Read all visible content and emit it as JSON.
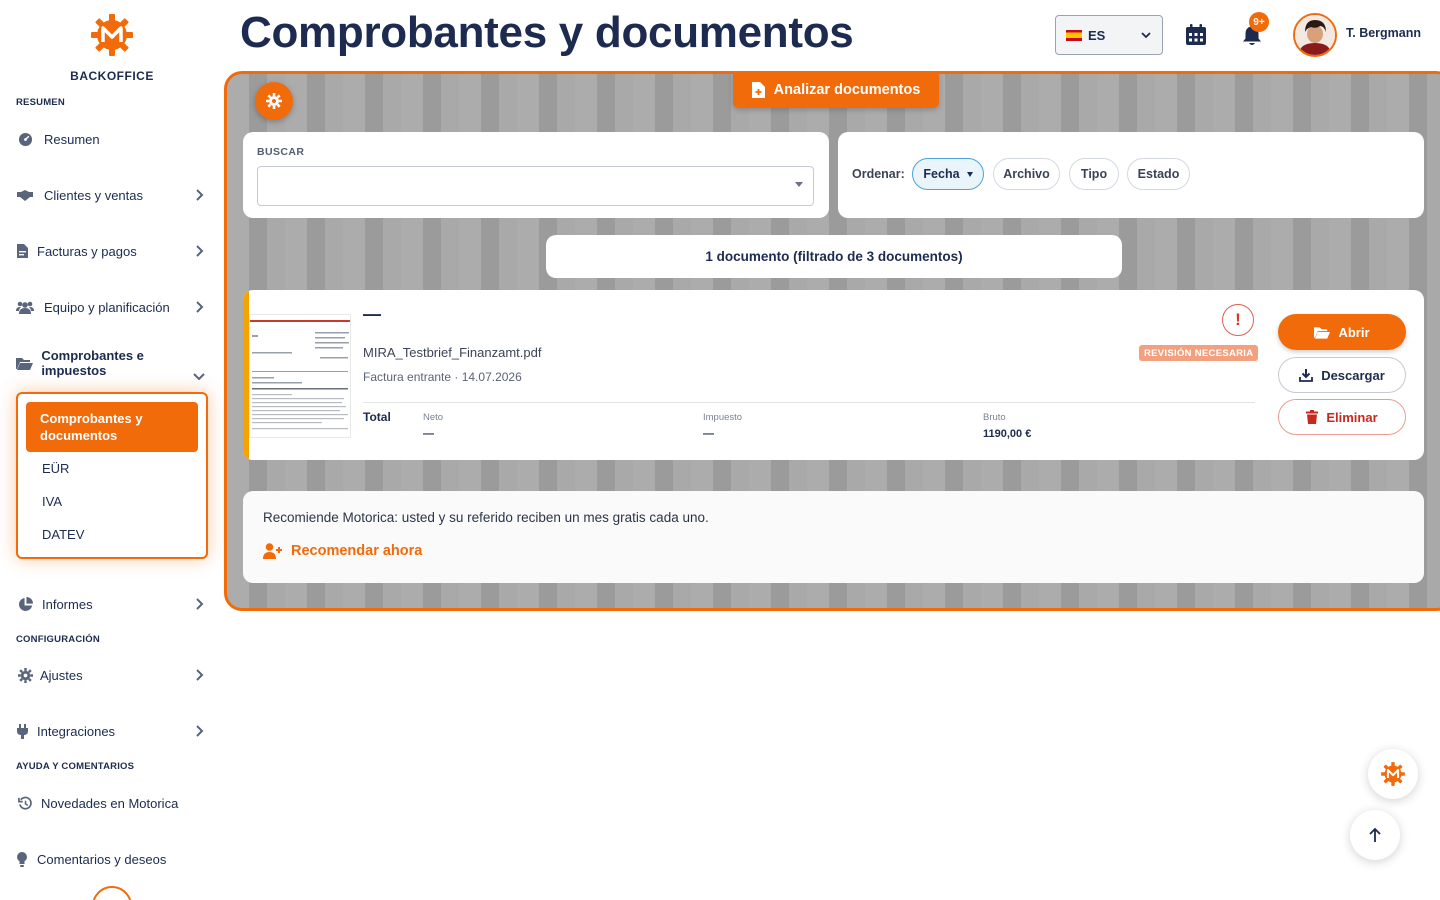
{
  "sidebar": {
    "brand": "BACKOFFICE",
    "sections": {
      "summary": "RESUMEN",
      "config": "CONFIGURACIÓN",
      "help": "AYUDA Y COMENTARIOS"
    },
    "items": {
      "resumen": "Resumen",
      "clientes": "Clientes y ventas",
      "facturas": "Facturas y pagos",
      "equipo": "Equipo y planificación",
      "comprobantes": "Comprobantes e impuestos",
      "informes": "Informes",
      "ajustes": "Ajustes",
      "integraciones": "Integraciones",
      "novedades": "Novedades en Motorica",
      "comentarios": "Comentarios y deseos"
    },
    "subitems": {
      "active": "Comprobantes y documentos",
      "eur": "EÜR",
      "iva": "IVA",
      "datev": "DATEV"
    }
  },
  "header": {
    "title": "Comprobantes y documentos",
    "language": "ES",
    "notification_badge": "9+",
    "user_name": "T. Bergmann"
  },
  "toolbar": {
    "analyze_label": "Analizar documentos"
  },
  "search": {
    "label": "BUSCAR",
    "value": "",
    "placeholder": ""
  },
  "sort": {
    "label": "Ordenar:",
    "options": [
      "Fecha",
      "Archivo",
      "Tipo",
      "Estado"
    ],
    "selected": "Fecha"
  },
  "results": {
    "summary": "1 documento (filtrado de 3 documentos)"
  },
  "document": {
    "title": "—",
    "filename": "MIRA_Testbrief_Finanzamt.pdf",
    "meta": "Factura entrante · 14.07.2026",
    "status": "REVISIÓN NECESARIA",
    "total_label": "Total",
    "columns": [
      {
        "label": "Neto",
        "value": "—"
      },
      {
        "label": "Impuesto",
        "value": "—"
      },
      {
        "label": "Bruto",
        "value": "1190,00 €"
      }
    ],
    "actions": {
      "open": "Abrir",
      "download": "Descargar",
      "delete": "Eliminar"
    }
  },
  "referral": {
    "text": "Recomiende Motorica: usted y su referido reciben un mes gratis cada uno.",
    "link": "Recomendar ahora"
  },
  "colors": {
    "accent": "#f26b0a",
    "navy": "#1c2b4f",
    "warning_stripe": "#f5a300",
    "danger": "#c8281e"
  },
  "icons": [
    "gear-icon",
    "file-plus-icon",
    "calendar-icon",
    "bell-icon",
    "folder-open-icon",
    "download-icon",
    "trash-icon",
    "user-plus-icon",
    "arrow-up-icon"
  ]
}
